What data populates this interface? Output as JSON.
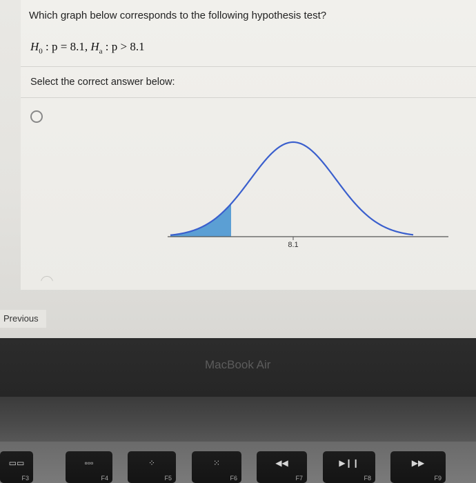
{
  "question": {
    "text": "Which graph below corresponds to the following hypothesis test?",
    "hypothesis": {
      "h0_symbol": "H",
      "h0_sub": "0",
      "h0_rest": " : p = 8.1, ",
      "ha_symbol": "H",
      "ha_sub": "a",
      "ha_rest": " : p > 8.1"
    },
    "prompt": "Select the correct answer below:"
  },
  "options": [
    {
      "graph": {
        "center_label": "8.1",
        "shaded_tail": "left",
        "curve_color": "#3a5fcd",
        "shade_color": "#5b9fd4"
      }
    }
  ],
  "nav": {
    "previous_label": "Previous"
  },
  "device": {
    "brand": "MacBook Air"
  },
  "keys": [
    {
      "label": "F3",
      "icon": "mission-control-icon"
    },
    {
      "label": "F4",
      "icon": "launchpad-icon"
    },
    {
      "label": "F5",
      "icon": "keyboard-brightness-down-icon"
    },
    {
      "label": "F6",
      "icon": "keyboard-brightness-up-icon"
    },
    {
      "label": "F7",
      "icon": "rewind-icon"
    },
    {
      "label": "F8",
      "icon": "play-pause-icon"
    },
    {
      "label": "F9",
      "icon": "fast-forward-icon"
    }
  ]
}
